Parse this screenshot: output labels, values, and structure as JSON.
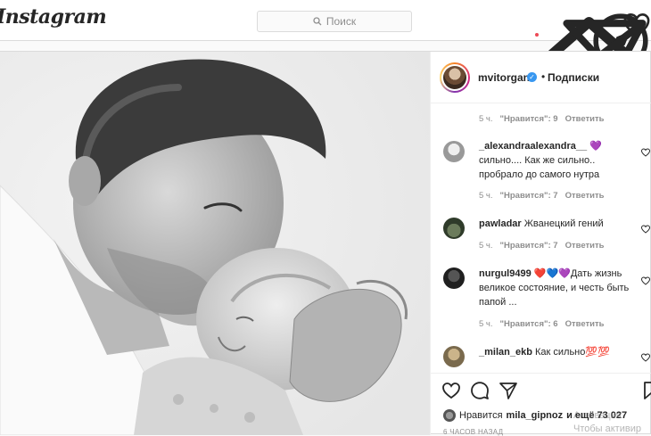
{
  "header": {
    "logo": "Instagram",
    "search_placeholder": "Поиск",
    "nav_icons": [
      "home-icon",
      "direct-icon",
      "explore-icon",
      "activity-heart-icon"
    ]
  },
  "post": {
    "username": "mvitorgan",
    "separator": "•",
    "follow_label": "Подписки",
    "comments": [
      {
        "user": "",
        "text": "",
        "time": "5 ч.",
        "likes": "\"Нравится\": 9",
        "reply": "Ответить"
      },
      {
        "user": "_alexandraalexandra__",
        "text": "💜 сильно.... Как же сильно.. пробрало до самого нутра",
        "time": "5 ч.",
        "likes": "\"Нравится\": 7",
        "reply": "Ответить"
      },
      {
        "user": "pawladar",
        "text": "Жванецкий гений",
        "time": "5 ч.",
        "likes": "\"Нравится\": 7",
        "reply": "Ответить"
      },
      {
        "user": "nurgul9499",
        "text": "❤️💙💜Дать жизнь великое состояние, и честь быть папой ...",
        "time": "5 ч.",
        "likes": "\"Нравится\": 6",
        "reply": "Ответить"
      },
      {
        "user": "_milan_ekb",
        "text": "Как сильно💯💯",
        "time": "",
        "likes": "",
        "reply": ""
      }
    ],
    "liked_by_prefix": "Нравится",
    "liked_by_user": "mila_gipnoz",
    "liked_by_suffix": "и ещё 73 027",
    "timestamp": "6 ЧАСОВ НАЗАД",
    "watermark_line1": "Активация",
    "watermark_line2": "Чтобы активир"
  },
  "colors": {
    "accent_blue": "#3897f0",
    "heart_red": "#ed4956",
    "border": "#dbdbdb",
    "muted": "#8e8e8e"
  }
}
